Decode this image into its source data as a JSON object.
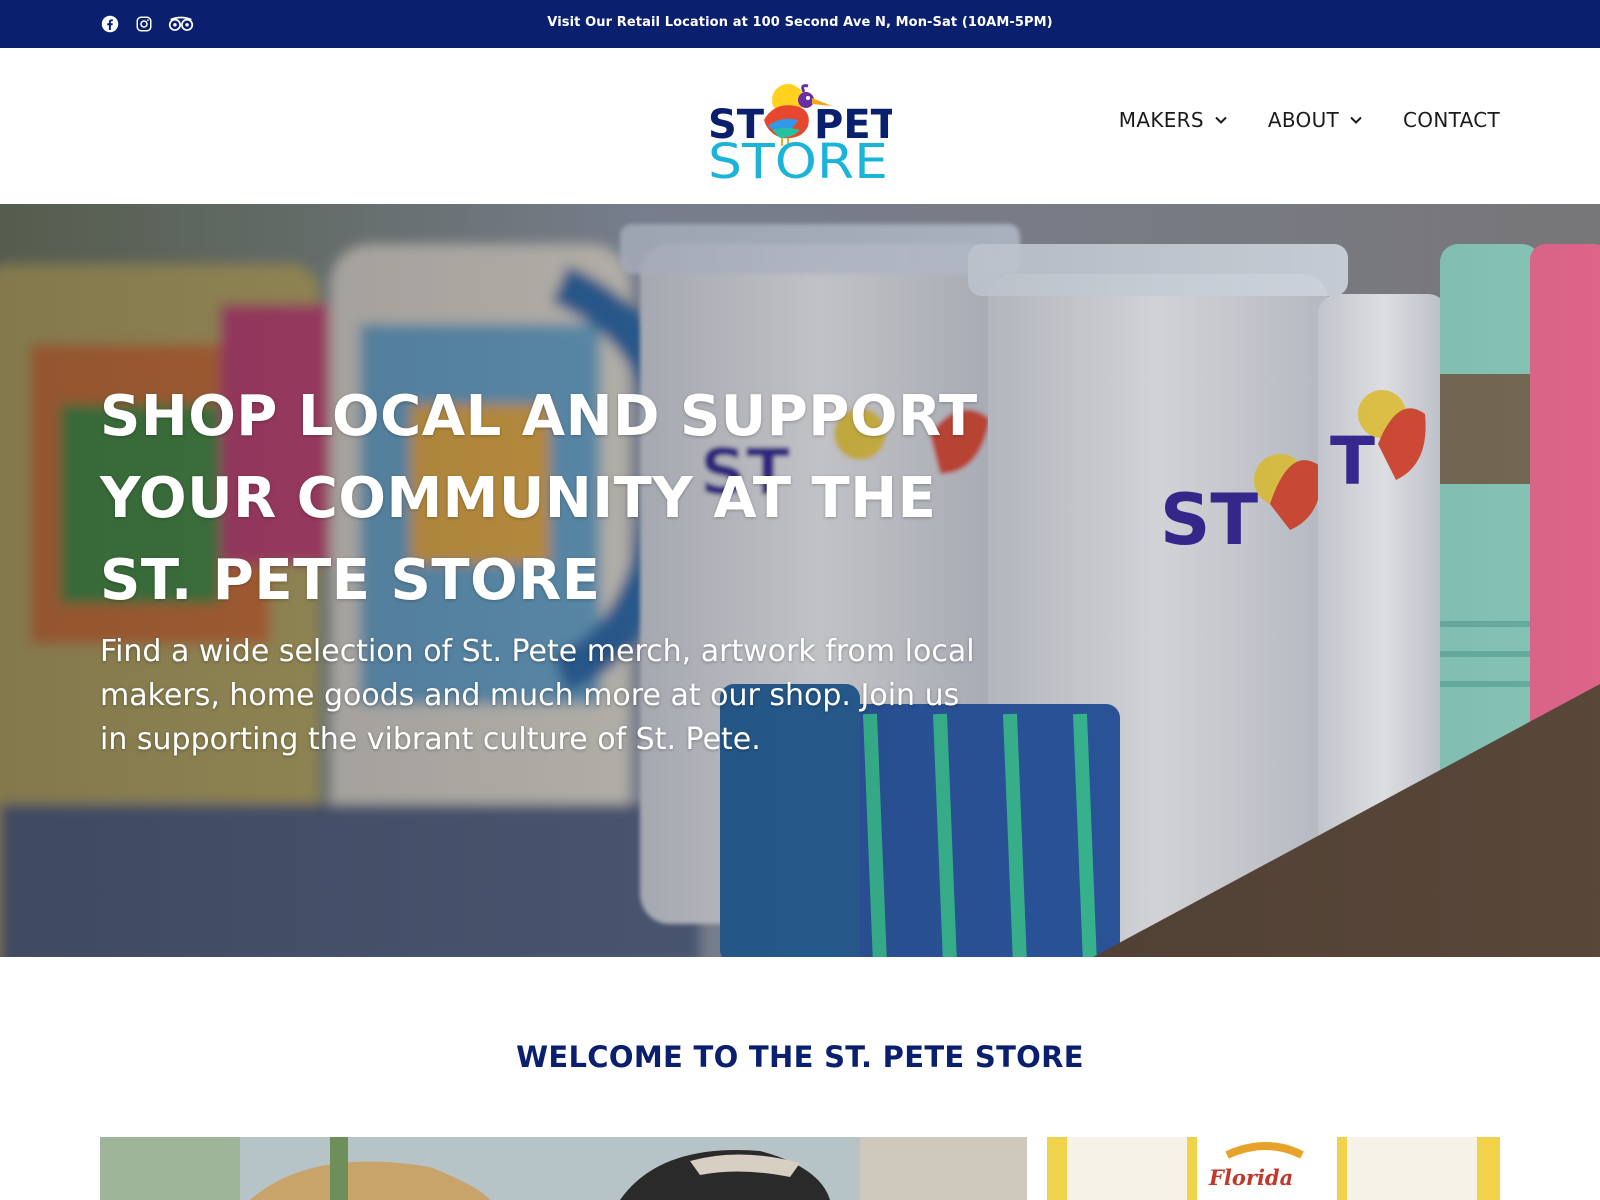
{
  "topbar": {
    "announcement": "Visit Our Retail Location at 100 Second Ave N, Mon-Sat (10AM-5PM)",
    "social_icons": [
      "facebook-icon",
      "instagram-icon",
      "tripadvisor-icon"
    ]
  },
  "header": {
    "logo": {
      "line1": "ST PETE",
      "line2": "STORE"
    },
    "nav": [
      {
        "label": "MAKERS",
        "has_dropdown": true
      },
      {
        "label": "ABOUT",
        "has_dropdown": true
      },
      {
        "label": "CONTACT",
        "has_dropdown": false
      }
    ]
  },
  "hero": {
    "title_line1": "SHOP LOCAL AND SUPPORT",
    "title_line2": "YOUR COMMUNITY AT THE",
    "title_line3": "ST. PETE STORE",
    "subtitle": "Find a wide selection of St. Pete merch, artwork from local makers, home goods and much more at our shop. Join us in supporting the vibrant culture of St. Pete."
  },
  "welcome": {
    "heading": "WELCOME TO THE ST. PETE STORE"
  },
  "photos": {
    "mug_text": "Florida"
  },
  "colors": {
    "navy": "#0a1f6e",
    "cyan": "#1ab4d8",
    "white": "#ffffff",
    "mug_red": "#c0392b"
  }
}
